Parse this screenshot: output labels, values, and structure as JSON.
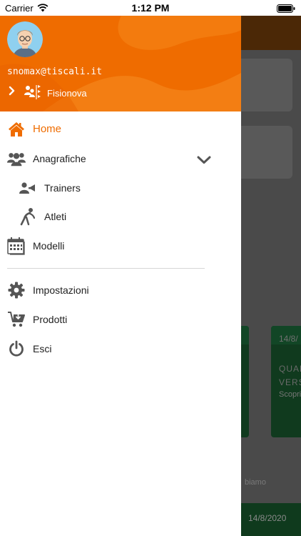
{
  "status_bar": {
    "carrier": "Carrier",
    "time": "1:12 PM"
  },
  "drawer": {
    "user_email": "snomax@tiscali.it",
    "center_name": "Fisionova",
    "menu": {
      "home": "Home",
      "registry": "Anagrafiche",
      "trainers": "Trainers",
      "athletes": "Atleti",
      "models": "Modelli",
      "settings": "Impostazioni",
      "products": "Prodotti",
      "logout": "Esci"
    }
  },
  "background": {
    "card_date": "14/8/",
    "card_line1": "QUAL",
    "card_line2": "VERS",
    "card_cta": "Scopri",
    "snippet": "biamo",
    "bottom_date": "14/8/2020"
  },
  "colors": {
    "accent": "#ef6c00",
    "icon_gray": "#555555"
  }
}
